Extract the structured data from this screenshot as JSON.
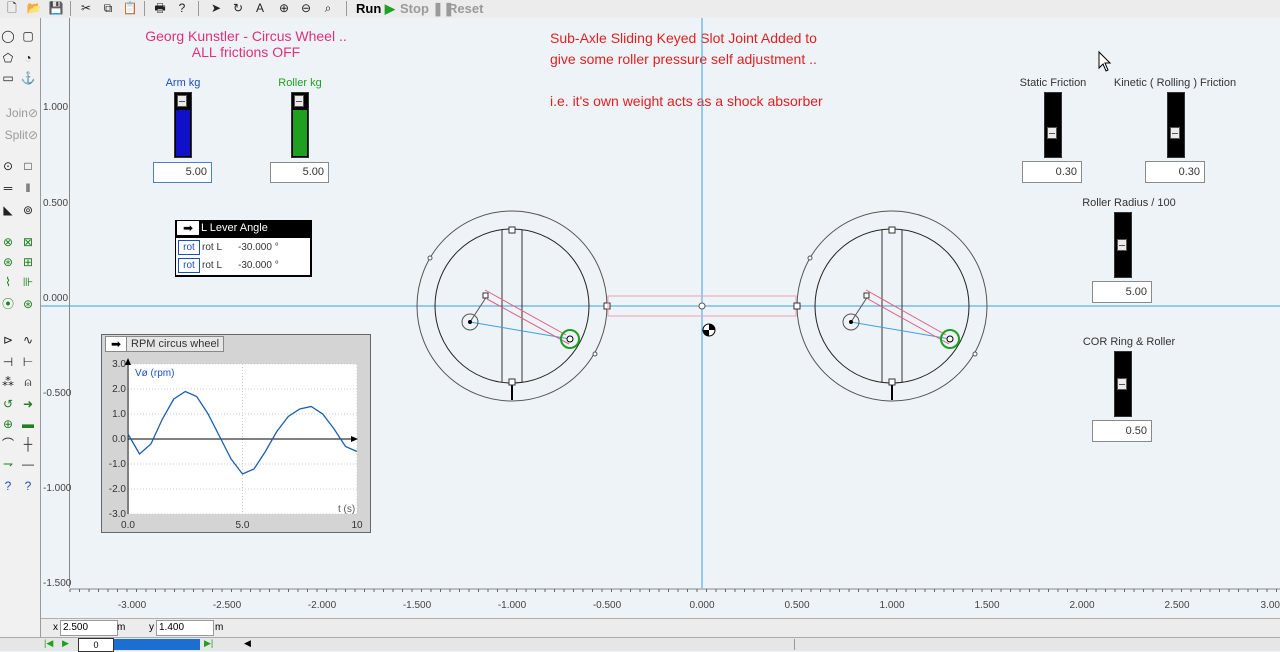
{
  "toolbar": {
    "run": "Run",
    "stop": "Stop",
    "reset": "Reset"
  },
  "lefttools": {
    "join": "Join",
    "split": "Split"
  },
  "notes": {
    "title_line1": "Georg Kunstler - Circus Wheel ..",
    "title_line2": "ALL frictions OFF",
    "desc_line1": "Sub-Axle Sliding Keyed Slot Joint Added to",
    "desc_line2": "give some roller pressure self adjustment ..",
    "desc_line3": "i.e. it's own weight acts as a shock absorber"
  },
  "sliders": {
    "arm": {
      "label": "Arm kg",
      "value": "5.00",
      "level": 1.0,
      "color": "#1010c8"
    },
    "roller": {
      "label": "Roller kg",
      "value": "5.00",
      "level": 1.0,
      "color": "#20a020"
    },
    "static_friction": {
      "label": "Static Friction",
      "value": "0.30"
    },
    "kinetic_friction": {
      "label": "Kinetic ( Rolling ) Friction",
      "value": "0.30"
    },
    "roller_radius": {
      "label": "Roller Radius / 100",
      "value": "5.00"
    },
    "cor": {
      "label": "COR Ring & Roller",
      "value": "0.50"
    }
  },
  "lever_panel": {
    "title": "L Lever Angle",
    "rows": [
      {
        "tag": "rot",
        "name": "rot L",
        "value": "-30.000 °"
      },
      {
        "tag": "rot",
        "name": "rot L",
        "value": "-30.000 °"
      }
    ]
  },
  "rpm_panel": {
    "title": "RPM circus wheel",
    "ylabel": "Vø (rpm)",
    "xlabel": "t (s)",
    "yticks": [
      "3.0",
      "2.0",
      "1.0",
      "0.0",
      "-1.0",
      "-2.0",
      "-3.0"
    ],
    "xticks": [
      "0.0",
      "5.0",
      "10"
    ]
  },
  "chart_data": {
    "type": "line",
    "title": "RPM circus wheel",
    "xlabel": "t (s)",
    "ylabel": "Vø (rpm)",
    "xlim": [
      0,
      10
    ],
    "ylim": [
      -3,
      3
    ],
    "series": [
      {
        "values_x": [
          0,
          0.5,
          1.0,
          1.5,
          2.0,
          2.5,
          3.0,
          3.5,
          4.0,
          4.5,
          5.0,
          5.5,
          6.0,
          6.5,
          7.0,
          7.5,
          8.0,
          8.5,
          9.0,
          9.5,
          10.0
        ],
        "values_y": [
          0.2,
          -0.6,
          -0.2,
          0.8,
          1.6,
          1.9,
          1.7,
          1.0,
          0.1,
          -0.8,
          -1.4,
          -1.2,
          -0.5,
          0.3,
          0.9,
          1.2,
          1.3,
          1.0,
          0.4,
          -0.3,
          -0.5
        ]
      }
    ]
  },
  "y_axis": [
    "1.000",
    "0.500",
    "0.000",
    "-0.500",
    "-1.000",
    "-1.500"
  ],
  "x_axis": [
    "-3.000",
    "-2.500",
    "-2.000",
    "-1.500",
    "-1.000",
    "-0.500",
    "0.000",
    "0.500",
    "1.000",
    "1.500",
    "2.000",
    "2.500",
    "3.00"
  ],
  "status": {
    "x_label": "x",
    "x_value": "2.500",
    "x_unit": "m",
    "y_label": "y",
    "y_value": "1.400",
    "y_unit": "m"
  },
  "bottom": {
    "frame": "0"
  }
}
